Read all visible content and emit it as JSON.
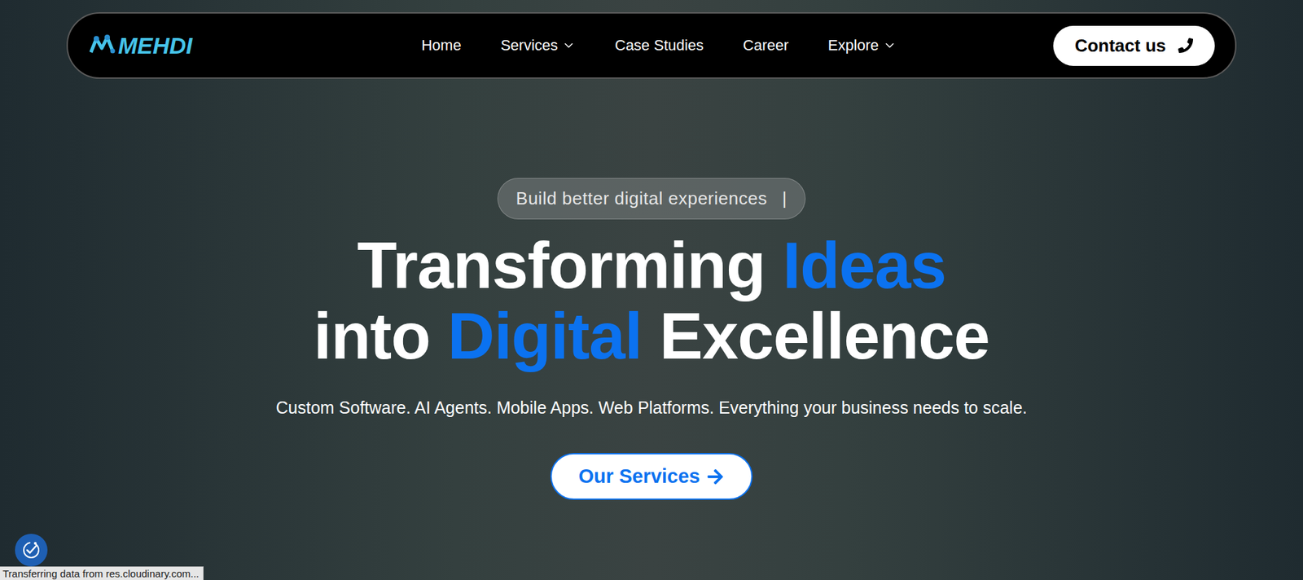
{
  "navbar": {
    "logo": "MEHDI",
    "links": [
      {
        "label": "Home",
        "dropdown": false
      },
      {
        "label": "Services",
        "dropdown": true
      },
      {
        "label": "Case Studies",
        "dropdown": false
      },
      {
        "label": "Career",
        "dropdown": false
      },
      {
        "label": "Explore",
        "dropdown": true
      }
    ],
    "contact_button": "Contact us"
  },
  "hero": {
    "badge": {
      "text": "Build better digital experiences",
      "cursor": "|"
    },
    "heading": [
      [
        {
          "text": "Transforming ",
          "highlight": false
        },
        {
          "text": "Ideas",
          "highlight": true
        }
      ],
      [
        {
          "text": "into ",
          "highlight": false
        },
        {
          "text": "Digital",
          "highlight": true
        },
        {
          "text": " Excellence",
          "highlight": false
        }
      ]
    ],
    "subtitle": "Custom Software. AI Agents. Mobile Apps. Web Platforms. Everything your business needs to scale.",
    "button": "Our Services"
  },
  "status_bar": "Transferring data from res.cloudinary.com..."
}
